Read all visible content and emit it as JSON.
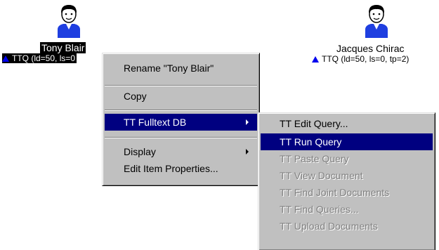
{
  "nodes": [
    {
      "name": "Tony Blair",
      "ttq": "TTQ (ld=50, ls=0",
      "selected": true
    },
    {
      "name": "Jacques Chirac",
      "ttq": "TTQ (ld=50, ls=0, tp=2)",
      "selected": false
    }
  ],
  "context_menu": {
    "items": [
      {
        "label": "Rename \"Tony Blair\""
      },
      {
        "label": "Copy"
      },
      {
        "label": "TT Fulltext DB",
        "submenu": true,
        "highlighted": true
      },
      {
        "label": "Display",
        "submenu": true
      },
      {
        "label": "Edit Item Properties..."
      }
    ]
  },
  "submenu": {
    "items": [
      {
        "label": "TT Edit Query...",
        "enabled": true
      },
      {
        "label": "TT Run Query",
        "enabled": true,
        "highlighted": true
      },
      {
        "label": "TT Paste Query",
        "enabled": false
      },
      {
        "label": "TT View Document",
        "enabled": false
      },
      {
        "label": "TT Find Joint Documents",
        "enabled": false
      },
      {
        "label": "TT Find Queries...",
        "enabled": false
      },
      {
        "label": "TT Upload Documents",
        "enabled": false
      }
    ]
  },
  "colors": {
    "highlight": "#000080",
    "menu_face": "#c0c0c0",
    "disabled_text": "#808080",
    "avatar_shirt": "#1f3fe0",
    "triangle": "#0000ee"
  },
  "icons": [
    "person-icon",
    "triangle-icon",
    "submenu-arrow-icon"
  ]
}
